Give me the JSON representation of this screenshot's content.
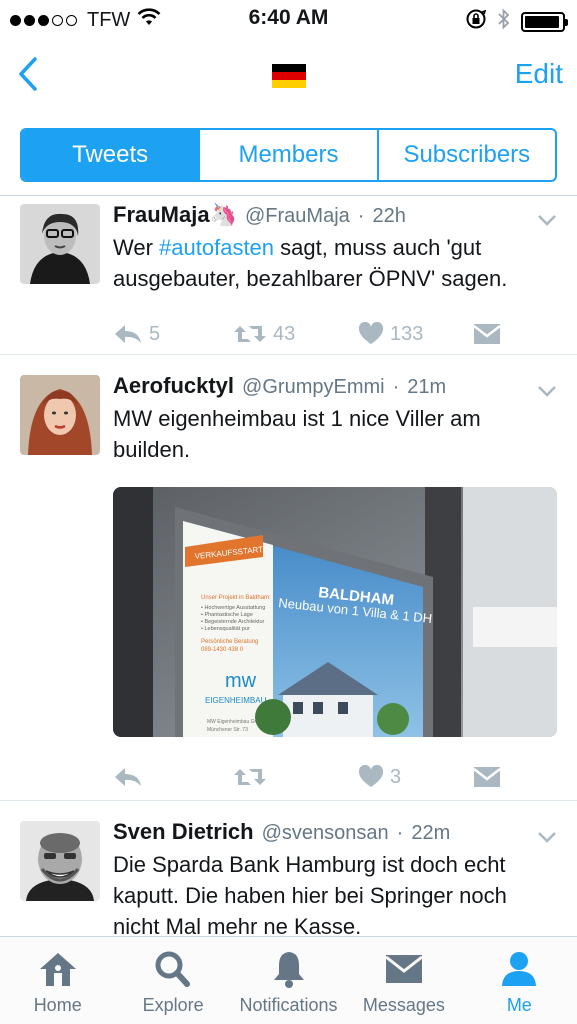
{
  "status_bar": {
    "carrier": "TFW",
    "time": "6:40 AM",
    "signal_bars": 3,
    "battery_level": 0.95
  },
  "nav": {
    "back_icon": "chevron-left-icon",
    "title_flag": "germany-flag",
    "edit_label": "Edit"
  },
  "segments": [
    {
      "label": "Tweets",
      "active": true
    },
    {
      "label": "Members",
      "active": false
    },
    {
      "label": "Subscribers",
      "active": false
    }
  ],
  "tweets": [
    {
      "name": "FrauMaja",
      "name_emoji": "🦄",
      "handle": "@FrauMaja",
      "time": "22h",
      "text_before": "Wer ",
      "hashtag": "#autofasten",
      "text_after": " sagt, muss auch 'gut ausgebauter, bezahlbarer ÖPNV' sagen.",
      "replies": "5",
      "retweets": "43",
      "likes": "133"
    },
    {
      "name": "Aerofucktyl",
      "handle": "@GrumpyEmmi",
      "time": "21m",
      "text": "MW eigenheimbau ist 1 nice Viller am builden.",
      "media": {
        "badge": "VERKAUFSSTART",
        "headline": "BALDHAM",
        "subline": "Neubau von 1 Villa & 1 DH",
        "left_title": "Unser Projekt in Baldham:",
        "bullets": [
          "• Hochwertige Ausstattung",
          "• Phantastische Lage",
          "• Begeisternde Architektur",
          "• Lebensqualität pur"
        ],
        "contact_label": "Persönliche Beratung",
        "phone": "089-1430 438 0",
        "brand_logo": "mw",
        "brand_name": "EIGENHEIMBAU",
        "company": "MW Eigenheimbau GmbH",
        "street": "Münchener Str. 73"
      },
      "replies": "",
      "retweets": "",
      "likes": "3"
    },
    {
      "name": "Sven Dietrich",
      "handle": "@svensonsan",
      "time": "22m",
      "text": "Die Sparda Bank Hamburg ist doch echt kaputt. Die haben hier bei Springer noch nicht Mal mehr ne Kasse."
    }
  ],
  "tabbar": [
    {
      "label": "Home",
      "icon": "home-icon",
      "active": false
    },
    {
      "label": "Explore",
      "icon": "search-icon",
      "active": false
    },
    {
      "label": "Notifications",
      "icon": "bell-icon",
      "active": false
    },
    {
      "label": "Messages",
      "icon": "envelope-icon",
      "active": false
    },
    {
      "label": "Me",
      "icon": "person-icon",
      "active": true
    }
  ],
  "colors": {
    "accent": "#1da1f2",
    "icon_gray": "#aab8c2",
    "text_gray": "#657786"
  }
}
